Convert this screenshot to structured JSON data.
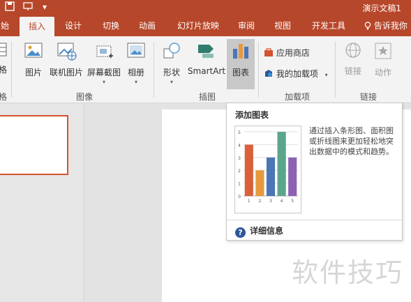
{
  "window": {
    "title": "演示文稿1",
    "quick_access": {
      "save_icon": "save-icon",
      "present_icon": "present-from-start-icon",
      "customize_icon": "customize-quick-access-icon"
    }
  },
  "tabs": [
    {
      "label": "始",
      "active": false
    },
    {
      "label": "插入",
      "active": true
    },
    {
      "label": "设计",
      "active": false
    },
    {
      "label": "切换",
      "active": false
    },
    {
      "label": "动画",
      "active": false
    },
    {
      "label": "幻灯片放映",
      "active": false
    },
    {
      "label": "审阅",
      "active": false
    },
    {
      "label": "视图",
      "active": false
    },
    {
      "label": "开发工具",
      "active": false
    }
  ],
  "tell_me": "告诉我你",
  "ribbon": {
    "partial_button": "格",
    "partial_group": "格",
    "images": {
      "group_label": "图像",
      "picture": "图片",
      "online_picture": "联机图片",
      "screenshot": "屏幕截图",
      "album": "相册"
    },
    "illustrations": {
      "group_label": "插图",
      "shapes": "形状",
      "smartart": "SmartArt",
      "chart": "图表"
    },
    "addins": {
      "group_label": "加载项",
      "store": "应用商店",
      "my_addins": "我的加载项"
    },
    "links": {
      "group_label": "链接",
      "link": "链接",
      "action": "动作"
    }
  },
  "tooltip": {
    "title": "添加图表",
    "description": "通过插入条形图、面积图或折线图来更加轻松地突出数据中的模式和趋势。",
    "help_label": "详细信息"
  },
  "watermark": "软件技巧",
  "chart_data": {
    "type": "bar",
    "categories": [
      "1",
      "2",
      "3",
      "4",
      "5"
    ],
    "values": [
      4,
      2,
      3,
      5,
      3
    ],
    "bar_colors": [
      "#d9603b",
      "#e69a3d",
      "#4a76b5",
      "#5aa58c",
      "#8e62b3"
    ],
    "y_ticks": [
      "0",
      "1",
      "2",
      "3",
      "4",
      "5"
    ],
    "ylim": [
      0,
      5
    ],
    "grid": true
  },
  "colors": {
    "accent": "#b7472a",
    "ribbon_bg": "#f3f3f3"
  }
}
